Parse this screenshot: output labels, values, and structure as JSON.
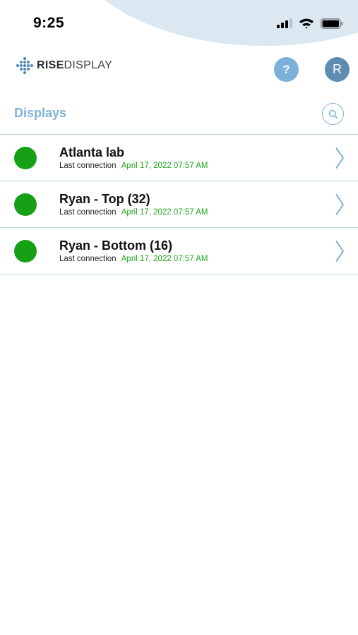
{
  "status_bar": {
    "time": "9:25"
  },
  "header": {
    "logo_bold": "RISE",
    "logo_light": "DISPLAY",
    "help_label": "?",
    "avatar_initial": "R"
  },
  "section": {
    "title": "Displays"
  },
  "displays": [
    {
      "name": "Atlanta lab",
      "last_connection_label": "Last connection",
      "last_connection": "April 17, 2022 07:57 AM"
    },
    {
      "name": "Ryan - Top (32)",
      "last_connection_label": "Last connection",
      "last_connection": "April 17, 2022 07:57 AM"
    },
    {
      "name": "Ryan - Bottom (16)",
      "last_connection_label": "Last connection",
      "last_connection": "April 17, 2022 07:57 AM"
    }
  ],
  "colors": {
    "online": "#15a015",
    "accent": "#7fb3d9",
    "avatar": "#5e8db3",
    "header_wave": "#dbe8f2"
  },
  "icons": {
    "status": [
      "cellular-signal-icon",
      "wifi-icon",
      "battery-icon"
    ],
    "search": "search-icon",
    "row": "chevron-right-icon"
  }
}
